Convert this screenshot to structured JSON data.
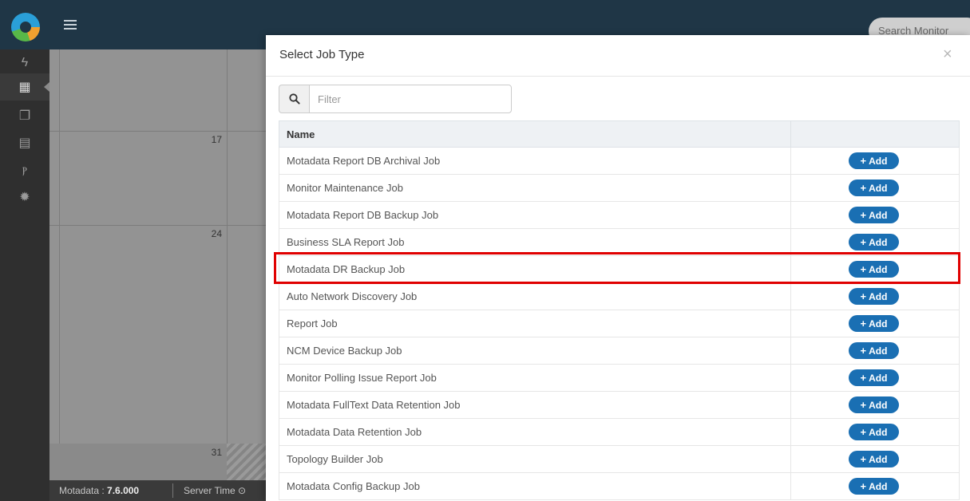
{
  "app": {
    "search_placeholder": "Search Monitor",
    "sidebar_icons": [
      "bolt-icon",
      "calendar-icon",
      "copy-icon",
      "document-icon",
      "branch-icon",
      "gear-icon"
    ],
    "calendar_days": [
      "17",
      "24",
      "31"
    ],
    "footer": {
      "version_label": "Motadata : ",
      "version": "7.6.000",
      "server_time_label": "Server Time ⊙"
    }
  },
  "modal": {
    "title": "Select Job Type",
    "close_label": "×",
    "filter": {
      "placeholder": "Filter",
      "value": ""
    },
    "table": {
      "columns": [
        "Name",
        ""
      ],
      "add_label": "Add",
      "rows": [
        {
          "name": "Motadata Report DB Archival Job"
        },
        {
          "name": "Monitor Maintenance Job"
        },
        {
          "name": "Motadata Report DB Backup Job"
        },
        {
          "name": "Business SLA Report Job"
        },
        {
          "name": "Motadata DR Backup Job"
        },
        {
          "name": "Auto Network Discovery Job"
        },
        {
          "name": "Report Job"
        },
        {
          "name": "NCM Device Backup Job"
        },
        {
          "name": "Monitor Polling Issue Report Job"
        },
        {
          "name": "Motadata FullText Data Retention Job"
        },
        {
          "name": "Motadata Data Retention Job"
        },
        {
          "name": "Topology Builder Job"
        },
        {
          "name": "Motadata Config Backup Job"
        }
      ]
    },
    "highlighted_row": "Motadata DR Backup Job"
  },
  "colors": {
    "topbar": "#1f3646",
    "add_button": "#1a6fb3",
    "highlight": "#e00000"
  }
}
